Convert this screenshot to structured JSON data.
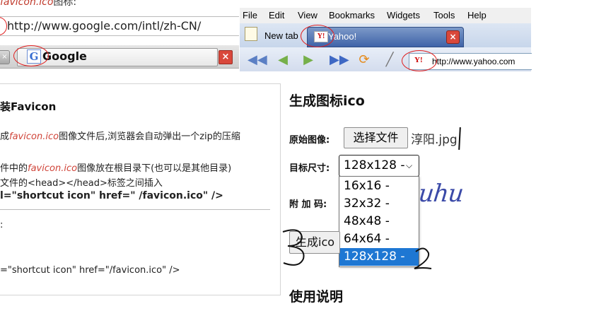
{
  "top_left_browser": {
    "caption_prefix": "",
    "caption_red": "favicon.ico",
    "caption_suffix": "图标:",
    "url": "http://www.google.com/intl/zh-CN/",
    "tab_icon_letter": "G",
    "tab_label": "Google",
    "close_glyph": "×"
  },
  "top_right_browser": {
    "menu": [
      "File",
      "Edit",
      "View",
      "Bookmarks",
      "Widgets",
      "Tools",
      "Help"
    ],
    "new_tab_label": "New tab",
    "yahoo_tab_label": "Yahoo!",
    "yahoo_logo": "Y!",
    "close_glyph": "×",
    "url": "http://www.yahoo.com",
    "toolbar_icons": [
      "rewind-icon",
      "back-icon",
      "forward-icon",
      "fast-forward-icon",
      "reload-icon",
      "wand-icon"
    ]
  },
  "help_panel": {
    "title": "装Favicon",
    "line1_prefix": "成",
    "line1_red": "favicon.ico",
    "line1_suffix": "图像文件后,浏览器会自动弹出一个zip的压缩",
    "line2_prefix": "件中的",
    "line2_red": "favicon.ico",
    "line2_suffix": "图像放在根目录下(也可以是其他目录)",
    "line3": "文件的<head></head>标签之间插入",
    "code_bold": "l=\"shortcut icon\" href=\" /favicon.ico\" />",
    "colon": ":",
    "code_plain": "=\"shortcut icon\" href=\"/favicon.ico\" />"
  },
  "form": {
    "title": "生成图标ico",
    "source_label": "原始图像:",
    "choose_file_button": "选择文件",
    "file_name": "淳阳.jpg",
    "size_label": "目标尺寸:",
    "selected_size": "128x128 -",
    "size_options": [
      "16x16 -",
      "32x32 -",
      "48x48 -",
      "64x64 -",
      "128x128 -"
    ],
    "selected_index": 4,
    "captcha_label": "附 加 码:",
    "captcha_text": "uhu",
    "generate_button": "生成ico",
    "usage_title": "使用说明"
  },
  "colors": {
    "accent_red": "#d0453a",
    "selection_blue": "#1e77d3",
    "annotation_red": "#e02020"
  }
}
